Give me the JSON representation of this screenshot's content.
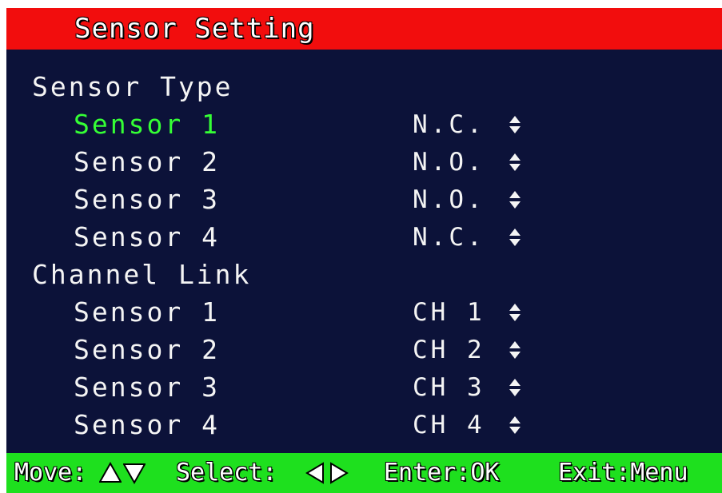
{
  "window": {
    "title": "Sensor Setting"
  },
  "sections": [
    {
      "heading": "Sensor Type",
      "items": [
        {
          "label": "Sensor 1",
          "value": "N.C.",
          "selected": true
        },
        {
          "label": "Sensor 2",
          "value": "N.O.",
          "selected": false
        },
        {
          "label": "Sensor 3",
          "value": "N.O.",
          "selected": false
        },
        {
          "label": "Sensor 4",
          "value": "N.C.",
          "selected": false
        }
      ]
    },
    {
      "heading": "Channel Link",
      "items": [
        {
          "label": "Sensor 1",
          "value": "CH 1",
          "selected": false
        },
        {
          "label": "Sensor 2",
          "value": "CH 2",
          "selected": false
        },
        {
          "label": "Sensor 3",
          "value": "CH 3",
          "selected": false
        },
        {
          "label": "Sensor 4",
          "value": "CH 4",
          "selected": false
        }
      ]
    }
  ],
  "status_bar": {
    "move_label": "Move:",
    "move_icons": [
      "up-triangle-icon",
      "down-triangle-icon"
    ],
    "select_label": "Select:",
    "select_icons": [
      "left-triangle-icon",
      "right-triangle-icon"
    ],
    "enter_label": "Enter:OK",
    "exit_label": "Exit:Menu"
  },
  "colors": {
    "title_bar": "#f20d0d",
    "panel_background": "#0c1239",
    "status_bar": "#1ee01e",
    "selected_text": "#35ff35",
    "text": "#f4f4f4"
  }
}
